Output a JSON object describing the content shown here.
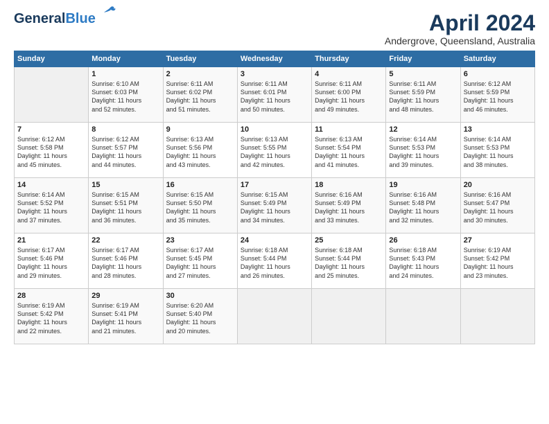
{
  "logo": {
    "general": "General",
    "blue": "Blue"
  },
  "title": "April 2024",
  "subtitle": "Andergrove, Queensland, Australia",
  "days_header": [
    "Sunday",
    "Monday",
    "Tuesday",
    "Wednesday",
    "Thursday",
    "Friday",
    "Saturday"
  ],
  "weeks": [
    [
      {
        "day": "",
        "info": ""
      },
      {
        "day": "1",
        "info": "Sunrise: 6:10 AM\nSunset: 6:03 PM\nDaylight: 11 hours\nand 52 minutes."
      },
      {
        "day": "2",
        "info": "Sunrise: 6:11 AM\nSunset: 6:02 PM\nDaylight: 11 hours\nand 51 minutes."
      },
      {
        "day": "3",
        "info": "Sunrise: 6:11 AM\nSunset: 6:01 PM\nDaylight: 11 hours\nand 50 minutes."
      },
      {
        "day": "4",
        "info": "Sunrise: 6:11 AM\nSunset: 6:00 PM\nDaylight: 11 hours\nand 49 minutes."
      },
      {
        "day": "5",
        "info": "Sunrise: 6:11 AM\nSunset: 5:59 PM\nDaylight: 11 hours\nand 48 minutes."
      },
      {
        "day": "6",
        "info": "Sunrise: 6:12 AM\nSunset: 5:59 PM\nDaylight: 11 hours\nand 46 minutes."
      }
    ],
    [
      {
        "day": "7",
        "info": "Sunrise: 6:12 AM\nSunset: 5:58 PM\nDaylight: 11 hours\nand 45 minutes."
      },
      {
        "day": "8",
        "info": "Sunrise: 6:12 AM\nSunset: 5:57 PM\nDaylight: 11 hours\nand 44 minutes."
      },
      {
        "day": "9",
        "info": "Sunrise: 6:13 AM\nSunset: 5:56 PM\nDaylight: 11 hours\nand 43 minutes."
      },
      {
        "day": "10",
        "info": "Sunrise: 6:13 AM\nSunset: 5:55 PM\nDaylight: 11 hours\nand 42 minutes."
      },
      {
        "day": "11",
        "info": "Sunrise: 6:13 AM\nSunset: 5:54 PM\nDaylight: 11 hours\nand 41 minutes."
      },
      {
        "day": "12",
        "info": "Sunrise: 6:14 AM\nSunset: 5:53 PM\nDaylight: 11 hours\nand 39 minutes."
      },
      {
        "day": "13",
        "info": "Sunrise: 6:14 AM\nSunset: 5:53 PM\nDaylight: 11 hours\nand 38 minutes."
      }
    ],
    [
      {
        "day": "14",
        "info": "Sunrise: 6:14 AM\nSunset: 5:52 PM\nDaylight: 11 hours\nand 37 minutes."
      },
      {
        "day": "15",
        "info": "Sunrise: 6:15 AM\nSunset: 5:51 PM\nDaylight: 11 hours\nand 36 minutes."
      },
      {
        "day": "16",
        "info": "Sunrise: 6:15 AM\nSunset: 5:50 PM\nDaylight: 11 hours\nand 35 minutes."
      },
      {
        "day": "17",
        "info": "Sunrise: 6:15 AM\nSunset: 5:49 PM\nDaylight: 11 hours\nand 34 minutes."
      },
      {
        "day": "18",
        "info": "Sunrise: 6:16 AM\nSunset: 5:49 PM\nDaylight: 11 hours\nand 33 minutes."
      },
      {
        "day": "19",
        "info": "Sunrise: 6:16 AM\nSunset: 5:48 PM\nDaylight: 11 hours\nand 32 minutes."
      },
      {
        "day": "20",
        "info": "Sunrise: 6:16 AM\nSunset: 5:47 PM\nDaylight: 11 hours\nand 30 minutes."
      }
    ],
    [
      {
        "day": "21",
        "info": "Sunrise: 6:17 AM\nSunset: 5:46 PM\nDaylight: 11 hours\nand 29 minutes."
      },
      {
        "day": "22",
        "info": "Sunrise: 6:17 AM\nSunset: 5:46 PM\nDaylight: 11 hours\nand 28 minutes."
      },
      {
        "day": "23",
        "info": "Sunrise: 6:17 AM\nSunset: 5:45 PM\nDaylight: 11 hours\nand 27 minutes."
      },
      {
        "day": "24",
        "info": "Sunrise: 6:18 AM\nSunset: 5:44 PM\nDaylight: 11 hours\nand 26 minutes."
      },
      {
        "day": "25",
        "info": "Sunrise: 6:18 AM\nSunset: 5:44 PM\nDaylight: 11 hours\nand 25 minutes."
      },
      {
        "day": "26",
        "info": "Sunrise: 6:18 AM\nSunset: 5:43 PM\nDaylight: 11 hours\nand 24 minutes."
      },
      {
        "day": "27",
        "info": "Sunrise: 6:19 AM\nSunset: 5:42 PM\nDaylight: 11 hours\nand 23 minutes."
      }
    ],
    [
      {
        "day": "28",
        "info": "Sunrise: 6:19 AM\nSunset: 5:42 PM\nDaylight: 11 hours\nand 22 minutes."
      },
      {
        "day": "29",
        "info": "Sunrise: 6:19 AM\nSunset: 5:41 PM\nDaylight: 11 hours\nand 21 minutes."
      },
      {
        "day": "30",
        "info": "Sunrise: 6:20 AM\nSunset: 5:40 PM\nDaylight: 11 hours\nand 20 minutes."
      },
      {
        "day": "",
        "info": ""
      },
      {
        "day": "",
        "info": ""
      },
      {
        "day": "",
        "info": ""
      },
      {
        "day": "",
        "info": ""
      }
    ]
  ]
}
